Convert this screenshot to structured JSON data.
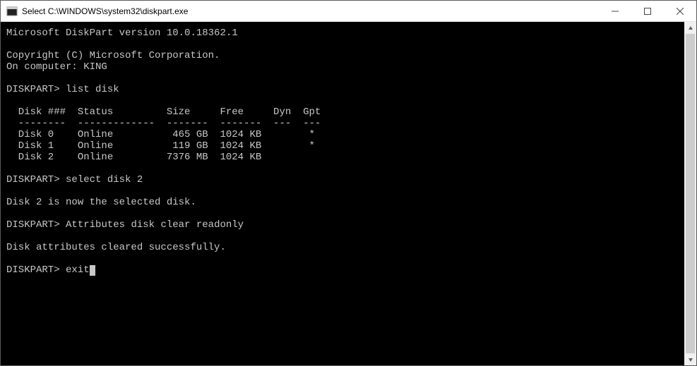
{
  "titlebar": {
    "prefix": "Select",
    "path": "C:\\WINDOWS\\system32\\diskpart.exe"
  },
  "terminal": {
    "version_line": "Microsoft DiskPart version 10.0.18362.1",
    "copyright_line": "Copyright (C) Microsoft Corporation.",
    "computer_line": "On computer: KING",
    "prompt": "DISKPART>",
    "cmd1": "list disk",
    "table": {
      "header": "  Disk ###  Status         Size     Free     Dyn  Gpt",
      "divider": "  --------  -------------  -------  -------  ---  ---",
      "rows": [
        "  Disk 0    Online          465 GB  1024 KB        *",
        "  Disk 1    Online          119 GB  1024 KB        *",
        "  Disk 2    Online         7376 MB  1024 KB"
      ]
    },
    "cmd2": "select disk 2",
    "resp2": "Disk 2 is now the selected disk.",
    "cmd3": "Attributes disk clear readonly",
    "resp3": "Disk attributes cleared successfully.",
    "cmd4": "exit"
  }
}
